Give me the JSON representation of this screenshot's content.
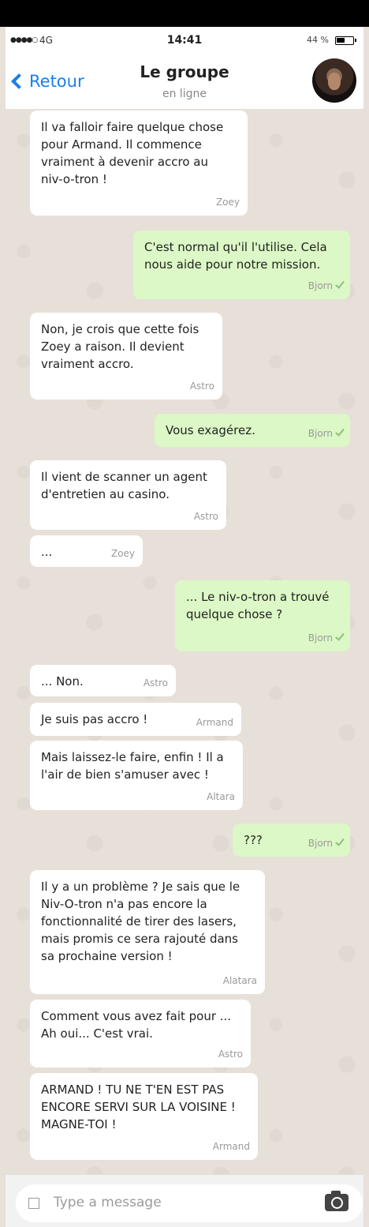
{
  "status": {
    "signal": "●●●●○",
    "network": "4G",
    "time": "14:41",
    "battery": "44 %"
  },
  "header": {
    "back_label": "Retour",
    "title": "Le groupe",
    "subtitle": "en ligne"
  },
  "messages": [
    {
      "dir": "in",
      "text": "Il va falloir faire quelque chose\npour Armand. Il commence\n vraiment à devenir accro au\nniv-o-tron !",
      "sender": "Zoey"
    },
    {
      "dir": "out",
      "text": "C'est normal qu'il l'utilise. Cela\nnous aide pour notre mission.",
      "sender": "Bjorn"
    },
    {
      "dir": "in",
      "text": "Non, je crois que cette fois\nZoey a raison. Il devient\nvraiment accro.",
      "sender": "Astro"
    },
    {
      "dir": "out",
      "text": "Vous exagérez.",
      "sender": "Bjorn"
    },
    {
      "dir": "in",
      "text": "Il vient de scanner un agent\nd'entretien au casino.",
      "sender": "Astro"
    },
    {
      "dir": "in",
      "text": "...",
      "sender": "Zoey"
    },
    {
      "dir": "out",
      "text": "... Le niv-o-tron a trouvé\nquelque chose ?",
      "sender": "Bjorn"
    },
    {
      "dir": "in",
      "text": "... Non.",
      "sender": "Astro"
    },
    {
      "dir": "in",
      "text": "Je suis pas accro !",
      "sender": "Armand"
    },
    {
      "dir": "in",
      "text": "Mais laissez-le faire, enfin ! Il a\nl'air de bien s'amuser avec !",
      "sender": "Altara"
    },
    {
      "dir": "out",
      "text": "???",
      "sender": "Bjorn"
    },
    {
      "dir": "in",
      "text": "Il y a un problème ? Je sais que le\nNiv-O-tron n'a pas encore la\nfonctionnalité de tirer des lasers,\nmais promis ce sera rajouté dans\nsa prochaine version !",
      "sender": "Alatara"
    },
    {
      "dir": "in",
      "text": "Comment vous avez fait pour ...\nAh oui... C'est vrai.",
      "sender": "Astro"
    },
    {
      "dir": "in",
      "text": "ARMAND ! TU NE T'EN EST PAS\nENCORE SERVI SUR LA VOISINE !\nMAGNE-TOI !",
      "sender": "Armand"
    }
  ],
  "input": {
    "placeholder": "Type a message"
  },
  "icons": {
    "back": "chevron-left-icon",
    "camera": "camera-icon",
    "attach": "checkbox-icon",
    "read": "check-icon"
  },
  "colors": {
    "accent": "#1a7fe6",
    "outgoing": "#dcf8c6",
    "incoming": "#ffffff"
  }
}
